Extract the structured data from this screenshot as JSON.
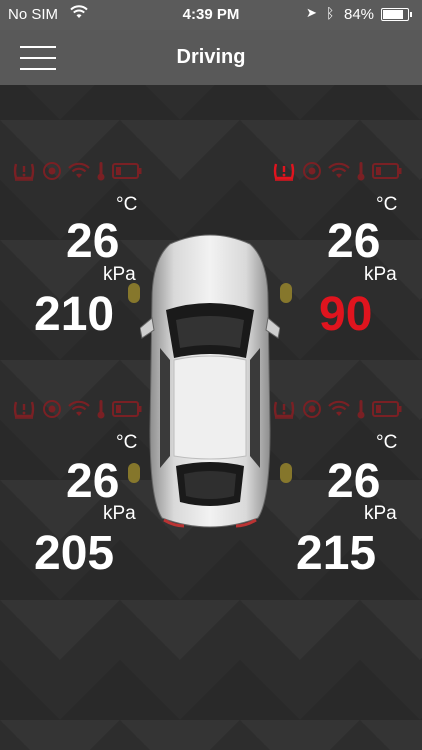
{
  "status_bar": {
    "carrier": "No SIM",
    "time": "4:39 PM",
    "battery_percent": "84%",
    "battery_level": 0.84
  },
  "nav": {
    "title": "Driving"
  },
  "units": {
    "temperature": "°C",
    "pressure": "kPa"
  },
  "tires": {
    "front_left": {
      "temperature": "26",
      "pressure": "210",
      "pressure_alert": false,
      "pressure_alert_icon": false
    },
    "front_right": {
      "temperature": "26",
      "pressure": "90",
      "pressure_alert": true,
      "pressure_alert_icon": true
    },
    "rear_left": {
      "temperature": "26",
      "pressure": "205",
      "pressure_alert": false,
      "pressure_alert_icon": false
    },
    "rear_right": {
      "temperature": "26",
      "pressure": "215",
      "pressure_alert": false,
      "pressure_alert_icon": false
    }
  },
  "colors": {
    "alert_red": "#e0141e",
    "dim_red": "#7a2024",
    "nav_gray": "#595959"
  }
}
